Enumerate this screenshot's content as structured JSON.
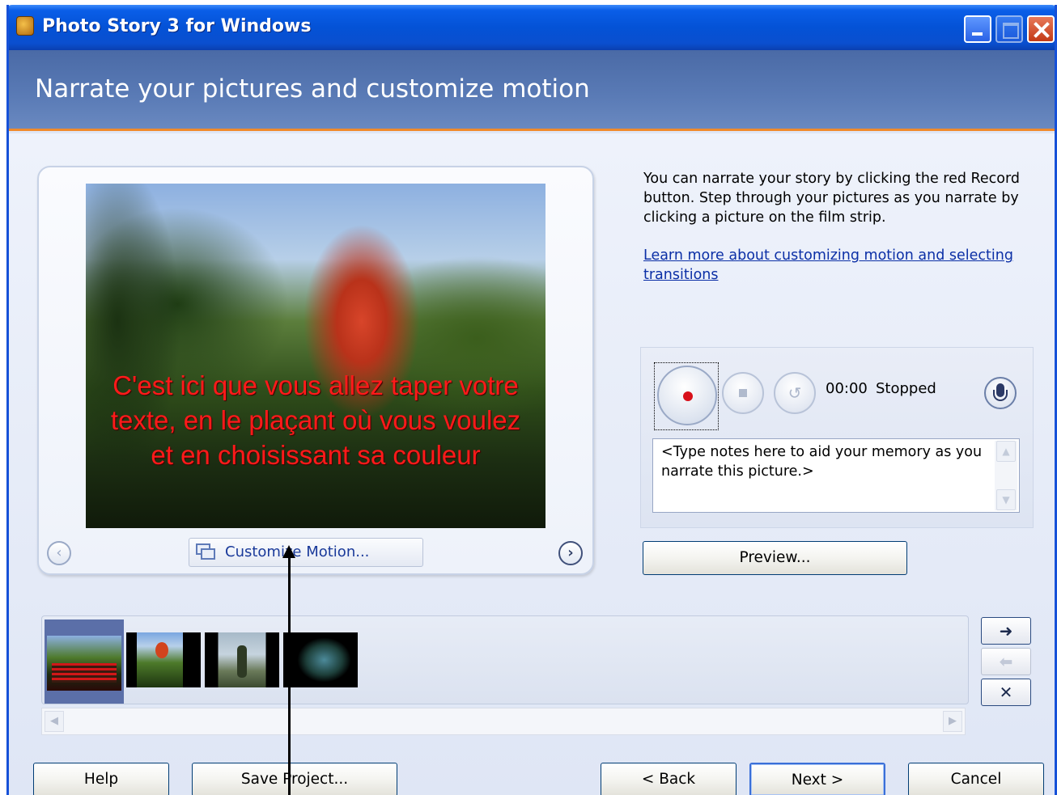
{
  "window": {
    "title": "Photo Story 3 for Windows"
  },
  "header": {
    "title": "Narrate your pictures and customize motion"
  },
  "preview": {
    "caption": "C'est ici que vous allez taper votre texte, en le plaçant où vous voulez et en choisissant sa couleur",
    "customize_motion_label": "Customize Motion...",
    "prev_label": "‹",
    "next_label": "›"
  },
  "instructions": {
    "text": "You can narrate your story by clicking the red Record button. Step through your pictures as you narrate by clicking a picture on the film strip.",
    "link": "Learn more about customizing motion and selecting transitions"
  },
  "recorder": {
    "time": "00:00",
    "status": "Stopped",
    "notes_placeholder": "<Type notes here to aid your memory as you narrate this picture.>"
  },
  "buttons": {
    "preview": "Preview...",
    "help": "Help",
    "save_project": "Save Project...",
    "back": "< Back",
    "next": "Next >",
    "cancel": "Cancel"
  },
  "filmstrip": {
    "move_right": "➜",
    "move_left": "⬅",
    "delete": "✕",
    "selected_index": 0,
    "thumbnail_count": 4
  },
  "colors": {
    "titlebar": "#0452d6",
    "header": "#5a7bb6",
    "accent_line": "#f08a2c",
    "caption_text": "#ff1a1a",
    "link": "#0b2fa6"
  }
}
